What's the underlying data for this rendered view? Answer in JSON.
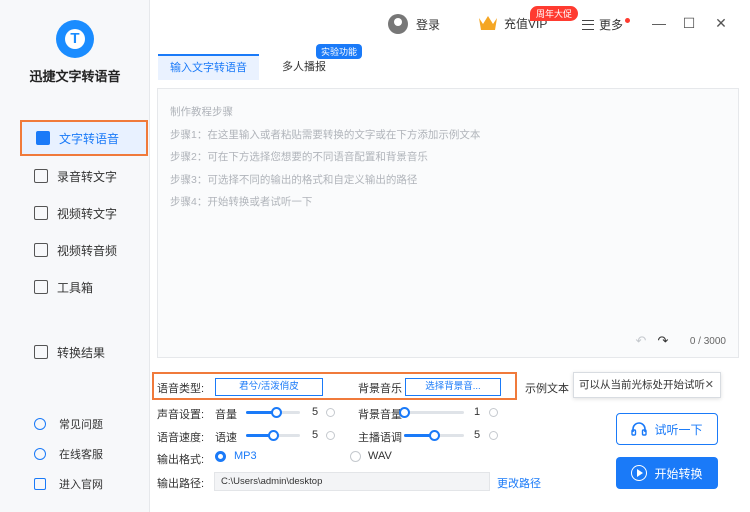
{
  "app": {
    "title": "迅捷文字转语音",
    "logo_letter": "T"
  },
  "sidebar": {
    "items": [
      {
        "label": "文字转语音",
        "icon": "text-to-speech-icon",
        "active": true
      },
      {
        "label": "录音转文字",
        "icon": "recording-icon"
      },
      {
        "label": "视频转文字",
        "icon": "video-text-icon"
      },
      {
        "label": "视频转音频",
        "icon": "video-audio-icon"
      },
      {
        "label": "工具箱",
        "icon": "toolbox-icon"
      },
      {
        "label": "转换结果",
        "icon": "results-icon"
      }
    ],
    "bottom": [
      {
        "label": "常见问题",
        "icon": "question-icon"
      },
      {
        "label": "在线客服",
        "icon": "headset-icon"
      },
      {
        "label": "进入官网",
        "icon": "monitor-icon"
      }
    ]
  },
  "topbar": {
    "login": "登录",
    "vip": "充值VIP",
    "promo": "周年大促",
    "more": "更多",
    "minimize": "—",
    "maximize": "☐",
    "close": "✕"
  },
  "tabs": [
    {
      "label": "输入文字转语音",
      "active": true
    },
    {
      "label": "多人播报",
      "badge": "实验功能"
    }
  ],
  "editor": {
    "placeholder_lines": [
      "制作教程步骤",
      "步骤1：在这里输入或者粘贴需要转换的文字或在下方添加示例文本",
      "步骤2：可在下方选择您想要的不同语音配置和背景音乐",
      "步骤3：可选择不同的输出的格式和自定义输出的路径",
      "步骤4：开始转换或者试听一下"
    ],
    "undo": "↶",
    "redo": "↷",
    "counter": "0 / 3000"
  },
  "settings": {
    "voice_type_label": "语音类型:",
    "voice_type_value": "君兮/活泼俏皮",
    "bgm_label": "背景音乐",
    "bgm_value": "选择背景音...",
    "sample_label": "示例文本",
    "tooltip": "可以从当前光标处开始试听",
    "tooltip_close": "✕",
    "sound_label": "声音设置:",
    "volume_label": "音量",
    "volume_value": "5",
    "volume_level": 0.55,
    "bg_volume_label": "背景音量",
    "bg_volume_value": "1",
    "bg_volume_level": 0.0,
    "speed_section_label": "语音速度:",
    "speed_label": "语速",
    "speed_value": "5",
    "speed_level": 0.5,
    "pitch_label": "主播语调",
    "pitch_value": "5",
    "pitch_level": 0.5,
    "format_label": "输出格式:",
    "format_mp3": "MP3",
    "format_wav": "WAV",
    "path_label": "输出路径:",
    "path_value": "C:\\Users\\admin\\desktop",
    "change_path": "更改路径"
  },
  "actions": {
    "listen": "试听一下",
    "start": "开始转换"
  },
  "colors": {
    "accent": "#1a7af8",
    "highlight": "#f07a3b",
    "promo": "#ff3b30"
  }
}
